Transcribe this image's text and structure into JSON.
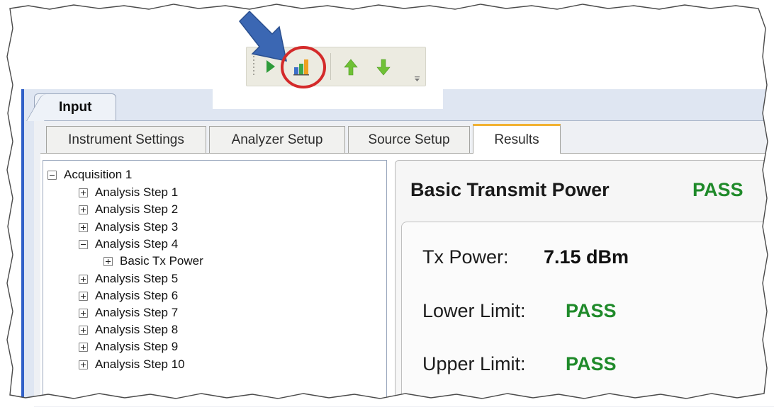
{
  "toolbar": {
    "buttons": [
      {
        "icon": "play-icon",
        "color": "#2e9b3a"
      },
      {
        "icon": "bar-chart-icon",
        "colors": [
          "#3d6fc9",
          "#3da84a",
          "#f0a020"
        ]
      },
      {
        "icon": "arrow-up-icon",
        "color": "#6fc135"
      },
      {
        "icon": "arrow-down-icon",
        "color": "#6fc135"
      }
    ],
    "highlight_color": "#d42a2a",
    "pointer_color": "#3b67b3"
  },
  "document_tab": {
    "label": "Input"
  },
  "tabs": [
    {
      "label": "Instrument Settings",
      "active": false
    },
    {
      "label": "Analyzer Setup",
      "active": false
    },
    {
      "label": "Source Setup",
      "active": false
    },
    {
      "label": "Results",
      "active": true
    }
  ],
  "tree": {
    "root": {
      "label": "Acquisition 1",
      "expanded": true
    },
    "steps": [
      {
        "label": "Analysis Step 1",
        "expanded": false
      },
      {
        "label": "Analysis Step 2",
        "expanded": false
      },
      {
        "label": "Analysis Step 3",
        "expanded": false
      },
      {
        "label": "Analysis Step 4",
        "expanded": true
      },
      {
        "label": "Basic Tx Power",
        "expanded": false,
        "child": true
      },
      {
        "label": "Analysis Step 5",
        "expanded": false
      },
      {
        "label": "Analysis Step 6",
        "expanded": false
      },
      {
        "label": "Analysis Step 7",
        "expanded": false
      },
      {
        "label": "Analysis Step 8",
        "expanded": false
      },
      {
        "label": "Analysis Step 9",
        "expanded": false
      },
      {
        "label": "Analysis Step 10",
        "expanded": false
      }
    ]
  },
  "results": {
    "title": "Basic Transmit Power",
    "status": "PASS",
    "pass_color": "#1f8a2a",
    "measurements": [
      {
        "label": "Tx Power:",
        "value": "7.15 dBm",
        "value_color": "#111111"
      },
      {
        "label": "Lower Limit:",
        "value": "PASS",
        "value_color": "#1f8a2a"
      },
      {
        "label": "Upper Limit:",
        "value": "PASS",
        "value_color": "#1f8a2a"
      }
    ]
  }
}
